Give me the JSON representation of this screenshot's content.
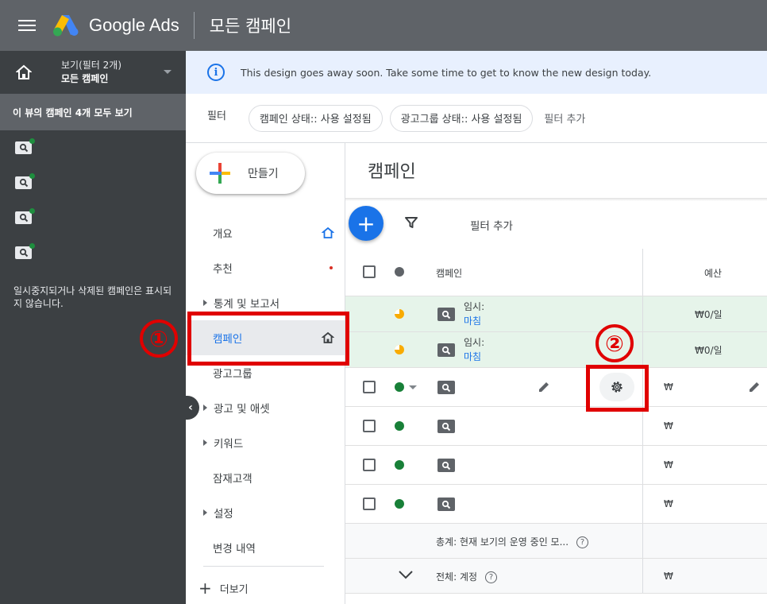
{
  "header": {
    "brand": "Google Ads",
    "page_title": "모든 캠페인"
  },
  "left_panel": {
    "view_label": "보기(필터 2개)",
    "view_value": "모든 캠페인",
    "all_campaigns": "이 뷰의 캠페인 4개 모두 보기",
    "note": "일시중지되거나 삭제된 캠페인은 표시되지 않습니다."
  },
  "banner": {
    "icon": "i",
    "text": "This design goes away soon. Take some time to get to know the new design today."
  },
  "filters": {
    "label": "필터",
    "chips": [
      "캠페인 상태:: 사용 설정됨",
      "광고그룹 상태:: 사용 설정됨"
    ],
    "add": "필터 추가"
  },
  "nav": {
    "create": "만들기",
    "items": [
      "개요",
      "추천",
      "통계 및 보고서",
      "캠페인",
      "광고그룹",
      "광고 및 애셋",
      "키워드",
      "잠재고객",
      "설정",
      "변경 내역"
    ],
    "more": "더보기"
  },
  "main": {
    "title": "캠페인",
    "toolbar_add_filter": "필터 추가",
    "col_campaign": "캠페인",
    "col_budget": "예산",
    "paused_rows": [
      {
        "status": "임시:",
        "name": "마침",
        "budget": "₩0/일"
      },
      {
        "status": "임시:",
        "name": "마침",
        "budget": "₩0/일"
      }
    ],
    "won": "₩",
    "total_running": "총계: 현재 보기의 운영 중인 모...",
    "total_account": "전체: 계정",
    "help": "?"
  },
  "annotations": {
    "one": "①",
    "two": "②",
    "color": "#e00000"
  },
  "colors": {
    "topbar": "#5f6368",
    "left_panel": "#3c4043",
    "accent": "#1a73e8",
    "paused_row": "#e6f4ea",
    "enabled": "#188038"
  }
}
